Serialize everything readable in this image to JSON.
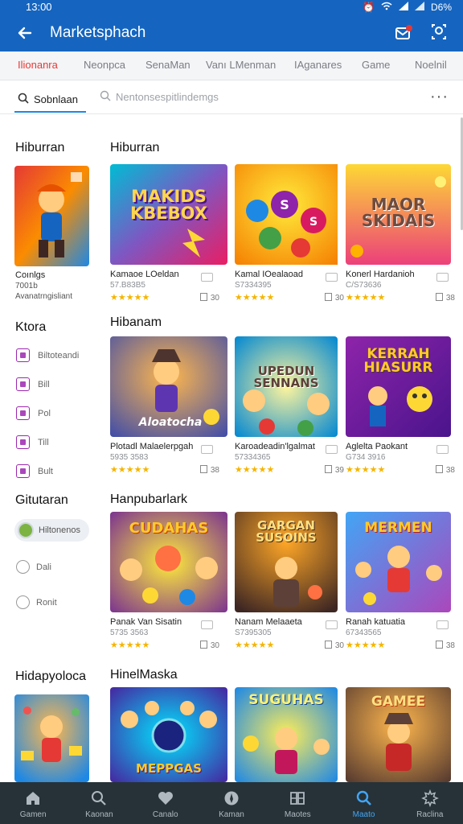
{
  "status": {
    "time": "13:00",
    "battery": "D6%"
  },
  "appbar": {
    "title": "Marketsphach"
  },
  "tabs": [
    "Ilionanra",
    "Neonpca",
    "SenaMan",
    "Vanı LMenman",
    "IAganares",
    "Game",
    "Noelnil"
  ],
  "search": {
    "segment_label": "Sobnlaan",
    "placeholder": "Nentonsespitlindemgs"
  },
  "sidebar": {
    "heading1": "Hiburran",
    "feature_title": "Coınlgs",
    "feature_meta1": "7001b",
    "feature_meta2": "Avanatrngisliant",
    "heading2": "Ktora",
    "categories": [
      "Biltoteandi",
      "Bill",
      "Pol",
      "Till",
      "Bult"
    ],
    "heading3": "Gitutaran",
    "pill_label": "Hiltonenos",
    "radios": [
      "Dali",
      "Ronit"
    ],
    "heading4": "Hidapyoloca"
  },
  "sections": [
    {
      "title": "Hiburran",
      "cards": [
        {
          "art": "MAKIDS KBEBOX",
          "title": "Kamaoe LOeldan",
          "meta": "57.B83B5",
          "count": "30"
        },
        {
          "art": "",
          "title": "Kamal IOealaoad",
          "meta": "S7334395",
          "count": "30"
        },
        {
          "art": "MAOR SKIDAIS",
          "title": "Konerl Hardanioh",
          "meta": "C/S73636",
          "count": "38"
        }
      ]
    },
    {
      "title": "Hibanam",
      "cards": [
        {
          "art": "Aloatocha",
          "title": "Plotadl Malaelerpgah",
          "meta": "5935 3583",
          "count": "38"
        },
        {
          "art": "UPEDUN SENNANS",
          "title": "Karoadeadin'lgalmat",
          "meta": "57334365",
          "count": "39"
        },
        {
          "art": "KERRAH HIASURR",
          "title": "Aglelta Paokant",
          "meta": "G734 3916",
          "count": "38"
        }
      ]
    },
    {
      "title": "Hanpubarlark",
      "cards": [
        {
          "art": "CUDAHAS",
          "title": "Panak Van Sisatin",
          "meta": "5735 3563",
          "count": "30"
        },
        {
          "art": "GARGAN SUSOINS",
          "title": "Nanam Melaaeta",
          "meta": "S7395305",
          "count": "30"
        },
        {
          "art": "MERMEN",
          "title": "Ranah katuatia",
          "meta": "67343565",
          "count": "38"
        }
      ]
    },
    {
      "title": "HinelMaska",
      "cards": [
        {
          "art": "MEPPGAS"
        },
        {
          "art": "SUGUHAS"
        },
        {
          "art": "GAMEE"
        }
      ]
    }
  ],
  "rating": "★★★★★",
  "bottom_nav": [
    "Gamen",
    "Kaonan",
    "Canalo",
    "Kaman",
    "Maotes",
    "Maato",
    "Raclina"
  ],
  "colors": {
    "appbar": "#1565c0",
    "accent": "#e53935",
    "nav_bg": "#263238",
    "nav_active": "#42a5f5"
  }
}
